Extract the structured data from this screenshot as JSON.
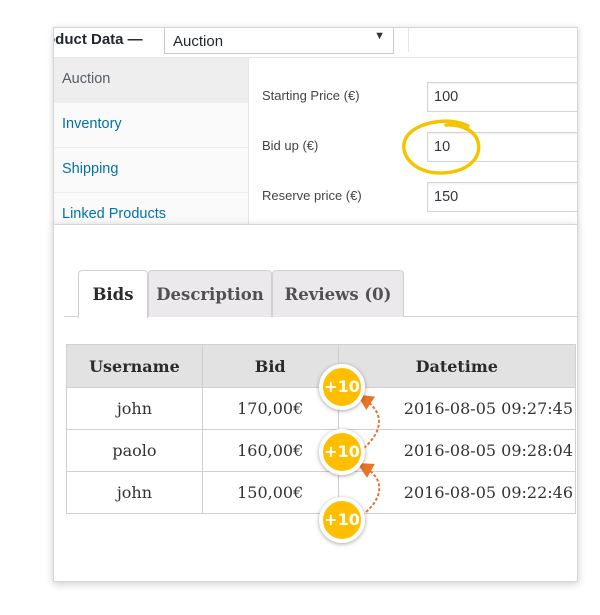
{
  "product_data": {
    "title": "oduct Data —",
    "type_select": "Auction",
    "tabs": [
      {
        "label": "Auction",
        "active": true
      },
      {
        "label": "Inventory",
        "active": false
      },
      {
        "label": "Shipping",
        "active": false
      },
      {
        "label": "Linked Products",
        "active": false
      }
    ],
    "fields": [
      {
        "label": "Starting Price (€)",
        "value": "100"
      },
      {
        "label": "Bid up (€)",
        "value": "10"
      },
      {
        "label": "Reserve price (€)",
        "value": "150"
      }
    ]
  },
  "product_tabs": [
    {
      "label": "Bids",
      "active": true
    },
    {
      "label": "Description",
      "active": false
    },
    {
      "label": "Reviews (0)",
      "active": false
    }
  ],
  "bids_table": {
    "headers": [
      "Username",
      "Bid",
      "Datetime"
    ],
    "rows": [
      [
        "john",
        "170,00€",
        "2016-08-05 09:27:45"
      ],
      [
        "paolo",
        "160,00€",
        "2016-08-05 09:28:04"
      ],
      [
        "john",
        "150,00€",
        "2016-08-05 09:22:46"
      ]
    ]
  },
  "badges": [
    "+10",
    "+10",
    "+10"
  ],
  "colors": {
    "link": "#0073aa",
    "badge": "#ffbf00",
    "highlight_circle": "#f5c400",
    "arrow": "#e8742a",
    "table_header": "#e2e2e2"
  }
}
